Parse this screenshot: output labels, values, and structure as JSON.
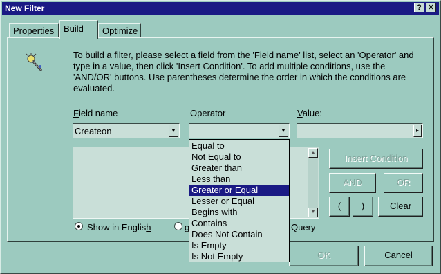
{
  "window": {
    "title": "New Filter",
    "help_glyph": "?",
    "close_glyph": "✕"
  },
  "tabs": [
    {
      "label": "Properties"
    },
    {
      "label": "Build"
    },
    {
      "label": "Optimize"
    }
  ],
  "instructions": "To build a filter, please select a field from the 'Field name' list, select an 'Operator' and type in a value, then click 'Insert Condition'. To add multiple conditions, use the 'AND/OR' buttons.  Use parentheses determine the order in which the conditions are evaluated.",
  "labels": {
    "field_name_first": "F",
    "field_name_rest": "ield name",
    "operator": "Operator",
    "value_first": "V",
    "value_rest": "alue:"
  },
  "field_name_value": "Createon",
  "operator_value": "",
  "value_value": "",
  "buttons": {
    "insert_condition": "Insert Condition",
    "and": "AND",
    "or": "OR",
    "open_paren": "(",
    "close_paren": ")",
    "clear": "Clear",
    "ok": "OK",
    "cancel": "Cancel"
  },
  "radios": {
    "show_in_english_prefix": "Show in Englis",
    "show_in_english_underlined": "h",
    "query_suffix": "Query",
    "partial_left": "g"
  },
  "operator_options": [
    "Equal to",
    "Not Equal to",
    "Greater than",
    "Less than",
    "Greater or Equal",
    "Lesser or Equal",
    "Begins with",
    "Contains",
    "Does Not Contain",
    "Is Empty",
    "Is Not Empty"
  ],
  "selected_operator_index": 4,
  "icons": {
    "wizard": "magic-wand-icon",
    "dropdown": "▼",
    "scroll_up": "▲",
    "scroll_down": "▼",
    "value_btn": "▸"
  },
  "colors": {
    "titlebar": "#1a1a84",
    "face": "#9ccabf",
    "field": "#c9dfd8",
    "selection": "#1a1a84"
  }
}
